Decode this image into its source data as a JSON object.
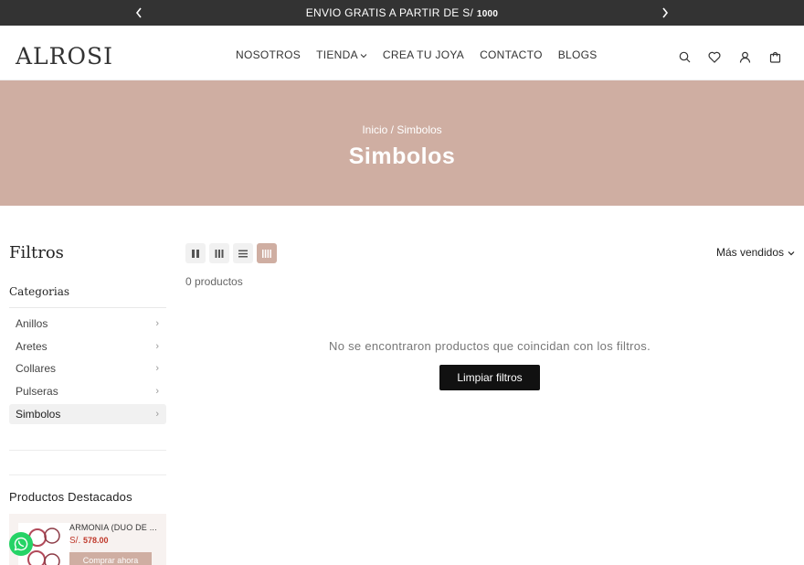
{
  "announcement": {
    "text": "ENVIO GRATIS A PARTIR DE S/",
    "amount": "1000"
  },
  "header": {
    "logo": "ALROSI",
    "nav": [
      "NOSOTROS",
      "TIENDA",
      "CREA TU JOYA",
      "CONTACTO",
      "BLOGS"
    ]
  },
  "hero": {
    "breadcrumb": "Inicio / Simbolos",
    "title": "Simbolos"
  },
  "sidebar": {
    "filters_title": "Filtros",
    "categories_title": "Categorias",
    "categories": [
      "Anillos",
      "Aretes",
      "Collares",
      "Pulseras",
      "Simbolos"
    ],
    "featured_title": "Productos Destacados",
    "featured": {
      "name": "ARMONIA (DUO DE ...",
      "currency": "S/.",
      "price": "578.00",
      "button": "Comprar ahora"
    }
  },
  "main": {
    "count": "0 productos",
    "sort": "Más vendidos",
    "empty_message": "No se encontraron productos que coincidan con los filtros.",
    "clear_button": "Limpiar filtros"
  },
  "colors": {
    "accent": "#cfaea2",
    "topbar": "#333333",
    "price": "#c0392b",
    "whatsapp": "#25d366"
  }
}
